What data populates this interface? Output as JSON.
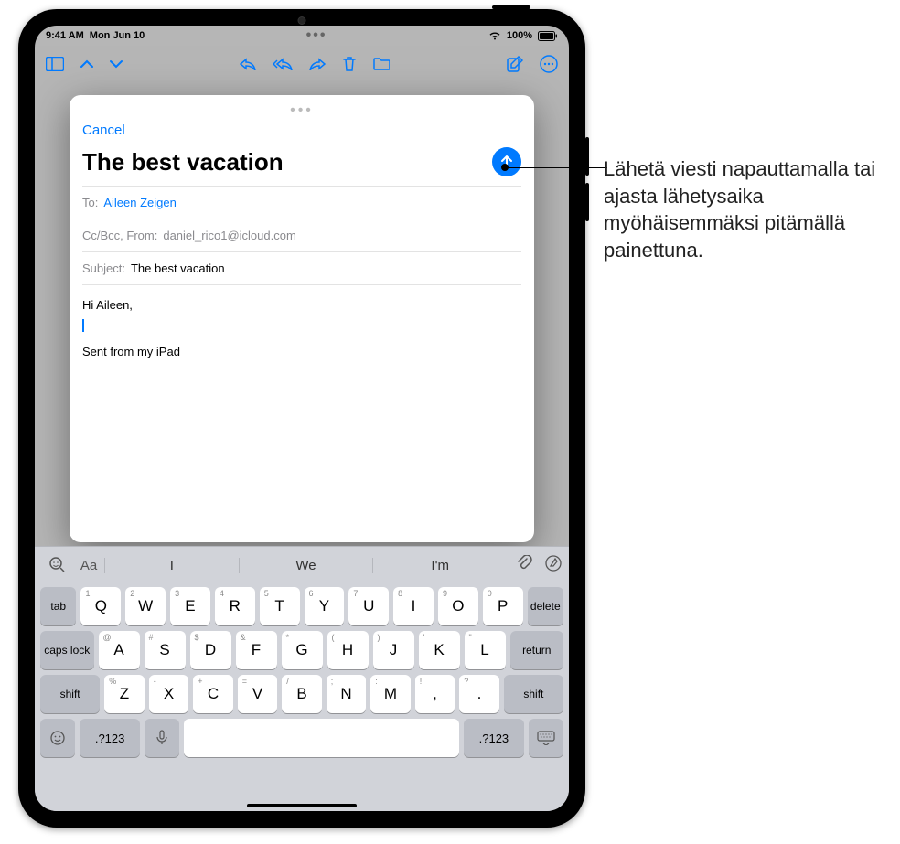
{
  "status": {
    "time": "9:41 AM",
    "date": "Mon Jun 10",
    "battery": "100%"
  },
  "toolbar": {},
  "compose": {
    "cancel": "Cancel",
    "title": "The best vacation",
    "to_label": "To:",
    "to_value": "Aileen Zeigen",
    "ccbcc_label": "Cc/Bcc, From:",
    "ccbcc_value": "daniel_rico1@icloud.com",
    "subject_label": "Subject:",
    "subject_value": "The best vacation",
    "body_greeting": "Hi Aileen,",
    "signature": "Sent from my iPad"
  },
  "keyboard": {
    "aa": "Aa",
    "pred1": "I",
    "pred2": "We",
    "pred3": "I'm",
    "row1": [
      {
        "main": "Q",
        "hint": "1"
      },
      {
        "main": "W",
        "hint": "2"
      },
      {
        "main": "E",
        "hint": "3"
      },
      {
        "main": "R",
        "hint": "4"
      },
      {
        "main": "T",
        "hint": "5"
      },
      {
        "main": "Y",
        "hint": "6"
      },
      {
        "main": "U",
        "hint": "7"
      },
      {
        "main": "I",
        "hint": "8"
      },
      {
        "main": "O",
        "hint": "9"
      },
      {
        "main": "P",
        "hint": "0"
      }
    ],
    "row2": [
      {
        "main": "A",
        "hint": "@"
      },
      {
        "main": "S",
        "hint": "#"
      },
      {
        "main": "D",
        "hint": "$"
      },
      {
        "main": "F",
        "hint": "&"
      },
      {
        "main": "G",
        "hint": "*"
      },
      {
        "main": "H",
        "hint": "("
      },
      {
        "main": "J",
        "hint": ")"
      },
      {
        "main": "K",
        "hint": "'"
      },
      {
        "main": "L",
        "hint": "\""
      }
    ],
    "row3": [
      {
        "main": "Z",
        "hint": "%"
      },
      {
        "main": "X",
        "hint": "-"
      },
      {
        "main": "C",
        "hint": "+"
      },
      {
        "main": "V",
        "hint": "="
      },
      {
        "main": "B",
        "hint": "/"
      },
      {
        "main": "N",
        "hint": ";"
      },
      {
        "main": "M",
        "hint": ":"
      },
      {
        "main": ",",
        "hint": "!"
      },
      {
        "main": ".",
        "hint": "?"
      }
    ],
    "tab": "tab",
    "delete": "delete",
    "caps": "caps lock",
    "return": "return",
    "shift": "shift",
    "sym": ".?123"
  },
  "callout": "Lähetä viesti napauttamalla tai ajasta lähetysaika myöhäisemmäksi pitämällä painettuna."
}
